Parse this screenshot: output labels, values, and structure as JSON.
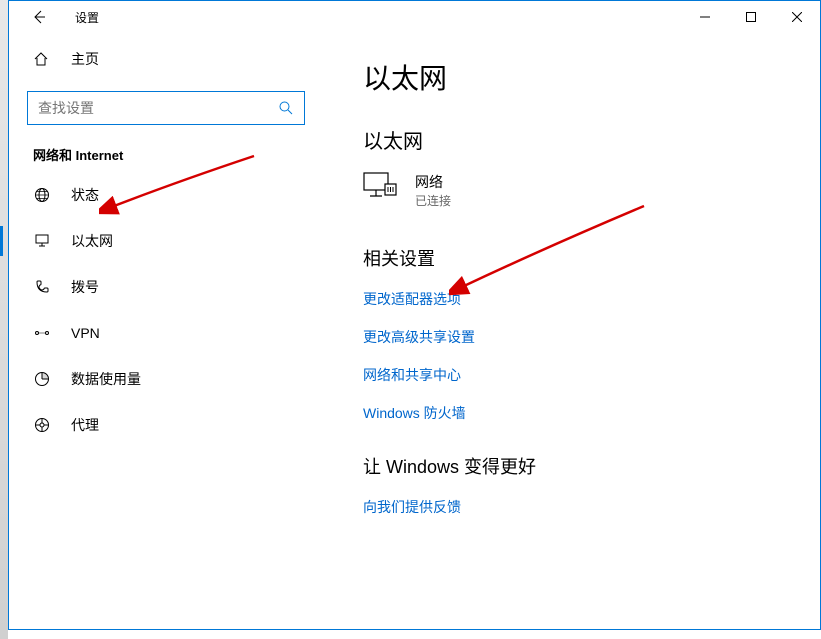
{
  "window": {
    "title": "设置"
  },
  "sidebar": {
    "home_label": "主页",
    "search_placeholder": "查找设置",
    "section_title": "网络和 Internet",
    "items": [
      {
        "label": "状态"
      },
      {
        "label": "以太网"
      },
      {
        "label": "拨号"
      },
      {
        "label": "VPN"
      },
      {
        "label": "数据使用量"
      },
      {
        "label": "代理"
      }
    ]
  },
  "main": {
    "page_title": "以太网",
    "sub_title": "以太网",
    "network": {
      "name": "网络",
      "status": "已连接"
    },
    "related_title": "相关设置",
    "links": [
      "更改适配器选项",
      "更改高级共享设置",
      "网络和共享中心",
      "Windows 防火墙"
    ],
    "improve_title": "让 Windows 变得更好",
    "feedback_link": "向我们提供反馈"
  }
}
